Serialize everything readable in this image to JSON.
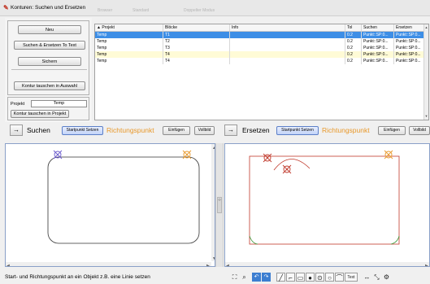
{
  "window": {
    "app_icon": "tool-icon",
    "title": "Konturen: Suchen und Ersetzen",
    "faded_text": [
      "Browser",
      "Standard",
      "Doppelter Modus"
    ]
  },
  "left_panel": {
    "neu": "Neu",
    "suchen_ersetzen_to_text": "Suchen & Ersetzen To Text",
    "sichern": "Sichern",
    "kontur_tauschen_auswahl": "Kontur tauschen in Auswahl",
    "projekt_label": "Projekt",
    "projekt_value": "Temp",
    "kontur_tauschen_projekt": "Kontur tauschen in Projekt"
  },
  "table": {
    "columns": [
      "▲ Projekt",
      "Blöcke",
      "Info",
      "Tol",
      "Suchen",
      "Ersetzen"
    ],
    "rows": [
      {
        "projekt": "Temp",
        "bloecke": "T1",
        "info": "",
        "tol": "0.2",
        "suchen": "Punkt::SP:0...",
        "ersetzen": "Punkt::SP:0..."
      },
      {
        "projekt": "Temp",
        "bloecke": "T2",
        "info": "",
        "tol": "0.2",
        "suchen": "Punkt::SP:0...",
        "ersetzen": "Punkt::SP:0..."
      },
      {
        "projekt": "Temp",
        "bloecke": "T3",
        "info": "",
        "tol": "0.2",
        "suchen": "Punkt::SP:0...",
        "ersetzen": "Punkt::SP:0..."
      },
      {
        "projekt": "Temp",
        "bloecke": "T4",
        "info": "",
        "tol": "0.2",
        "suchen": "Punkt::SP:0...",
        "ersetzen": "Punkt::SP:0..."
      },
      {
        "projekt": "Temp",
        "bloecke": "T4",
        "info": "",
        "tol": "0.2",
        "suchen": "Punkt::SP:0...",
        "ersetzen": "Punkt::SP:0..."
      }
    ]
  },
  "suchen_bar": {
    "arrow": "→",
    "label": "Suchen",
    "startpunkt": "Startpunkt Setzen",
    "richtungspunkt": "Richtungspunkt",
    "einfuegen": "Einfügen",
    "vollbild": "Vollbild"
  },
  "ersetzen_bar": {
    "arrow": "→",
    "label": "Ersetzen",
    "startpunkt": "Startpunkt Setzen",
    "richtungspunkt": "Richtungspunkt",
    "einfuegen": "Einfügen",
    "vollbild": "Vollbild"
  },
  "splitter": {
    "grip": "‹›"
  },
  "status": {
    "text": "Start- und Richtungspunkt an ein Objekt z.B. eine Linie setzen",
    "tools": [
      "zoom-fit-icon",
      "zoom-icon",
      "undo-icon",
      "redo-icon",
      "line-icon",
      "polyline-icon",
      "rectangle-icon",
      "point-icon",
      "circle-point-icon",
      "circle-icon",
      "arc-icon",
      "text-icon",
      "move-icon",
      "select-icon",
      "settings-icon"
    ],
    "text_tool_label": "Text"
  },
  "colors": {
    "selection": "#3d8ee6",
    "startpunkt": "#6a5acd",
    "richtungspunkt": "#e8982a",
    "suchen_contour": "#333333",
    "ersetzen_contour": "#c0392b"
  }
}
